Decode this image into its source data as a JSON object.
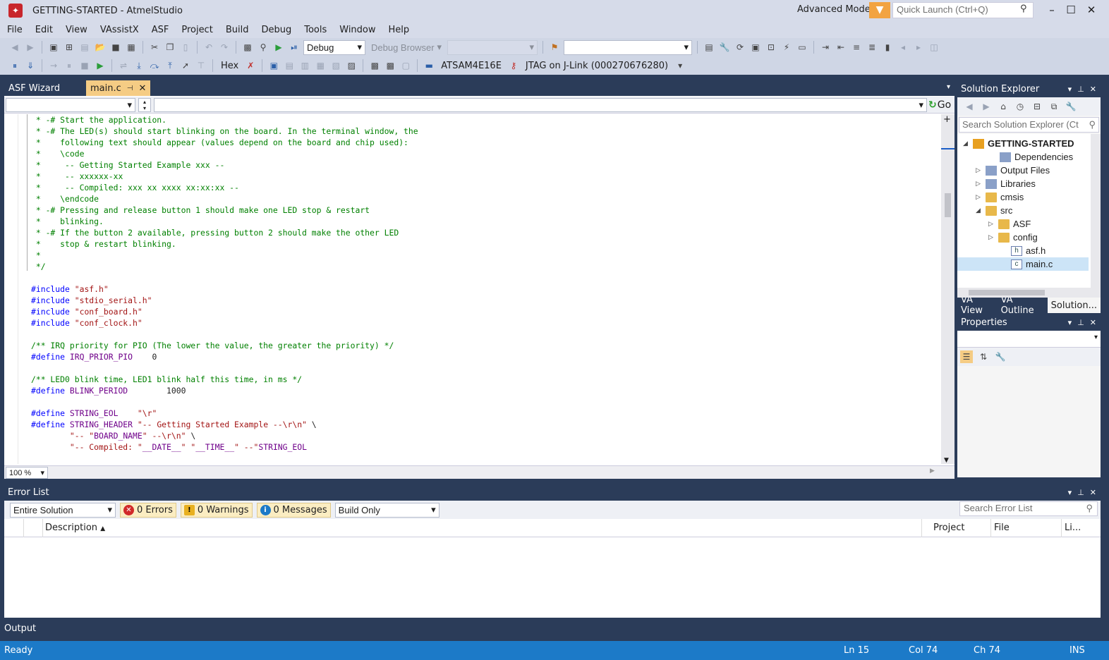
{
  "window": {
    "title": "GETTING-STARTED - AtmelStudio",
    "advanced_mode": "Advanced Mode",
    "quick_launch_placeholder": "Quick Launch (Ctrl+Q)"
  },
  "menu": [
    "File",
    "Edit",
    "View",
    "VAssistX",
    "ASF",
    "Project",
    "Build",
    "Debug",
    "Tools",
    "Window",
    "Help"
  ],
  "toolbar": {
    "config": "Debug",
    "debug_browser": "Debug Browser",
    "hex_label": "Hex",
    "device": "ATSAM4E16E",
    "tool": "JTAG on J-Link (000270676280)"
  },
  "tabs": {
    "asf_wizard": "ASF Wizard",
    "main_c": "main.c"
  },
  "nav": {
    "go": "Go"
  },
  "code_lines": [
    [
      {
        "c": "cm",
        "t": " * -# Start the application."
      }
    ],
    [
      {
        "c": "cm",
        "t": " * -# The LED(s) should start blinking on the board. In the terminal window, the"
      }
    ],
    [
      {
        "c": "cm",
        "t": " *    following text should appear (values depend on the board and chip used):"
      }
    ],
    [
      {
        "c": "cm",
        "t": " *    \\code"
      }
    ],
    [
      {
        "c": "cm",
        "t": " *     -- Getting Started Example xxx --"
      }
    ],
    [
      {
        "c": "cm",
        "t": " *     -- xxxxxx-xx"
      }
    ],
    [
      {
        "c": "cm",
        "t": " *     -- Compiled: xxx xx xxxx xx:xx:xx --"
      }
    ],
    [
      {
        "c": "cm",
        "t": " *    \\endcode"
      }
    ],
    [
      {
        "c": "cm",
        "t": " * -# Pressing and release button 1 should make one LED stop & restart"
      }
    ],
    [
      {
        "c": "cm",
        "t": " *    blinking."
      }
    ],
    [
      {
        "c": "cm",
        "t": " * -# If the button 2 available, pressing button 2 should make the other LED"
      }
    ],
    [
      {
        "c": "cm",
        "t": " *    stop & restart blinking."
      }
    ],
    [
      {
        "c": "cm",
        "t": " *"
      }
    ],
    [
      {
        "c": "cm",
        "t": " */"
      }
    ],
    [],
    [
      {
        "c": "kw",
        "t": "#include "
      },
      {
        "c": "st",
        "t": "\"asf.h\""
      }
    ],
    [
      {
        "c": "kw",
        "t": "#include "
      },
      {
        "c": "st",
        "t": "\"stdio_serial.h\""
      }
    ],
    [
      {
        "c": "kw",
        "t": "#include "
      },
      {
        "c": "st",
        "t": "\"conf_board.h\""
      }
    ],
    [
      {
        "c": "kw",
        "t": "#include "
      },
      {
        "c": "st",
        "t": "\"conf_clock.h\""
      }
    ],
    [],
    [
      {
        "c": "cm",
        "t": "/** IRQ priority for PIO (The lower the value, the greater the priority) */"
      }
    ],
    [
      {
        "c": "kw",
        "t": "#define "
      },
      {
        "c": "mc",
        "t": "IRQ_PRIOR_PIO"
      },
      {
        "c": "pl",
        "t": "    0"
      }
    ],
    [],
    [
      {
        "c": "cm",
        "t": "/** LED0 blink time, LED1 blink half this time, in ms */"
      }
    ],
    [
      {
        "c": "kw",
        "t": "#define "
      },
      {
        "c": "mc",
        "t": "BLINK_PERIOD"
      },
      {
        "c": "pl",
        "t": "        1000"
      }
    ],
    [],
    [
      {
        "c": "kw",
        "t": "#define "
      },
      {
        "c": "mc",
        "t": "STRING_EOL"
      },
      {
        "c": "pl",
        "t": "    "
      },
      {
        "c": "st",
        "t": "\"\\r\""
      }
    ],
    [
      {
        "c": "kw",
        "t": "#define "
      },
      {
        "c": "mc",
        "t": "STRING_HEADER "
      },
      {
        "c": "st",
        "t": "\"-- Getting Started Example --\\r\\n\""
      },
      {
        "c": "pl",
        "t": " \\"
      }
    ],
    [
      {
        "c": "pl",
        "t": "        "
      },
      {
        "c": "st",
        "t": "\"-- \""
      },
      {
        "c": "mc",
        "t": "BOARD_NAME"
      },
      {
        "c": "st",
        "t": "\" --\\r\\n\""
      },
      {
        "c": "pl",
        "t": " \\"
      }
    ],
    [
      {
        "c": "pl",
        "t": "        "
      },
      {
        "c": "st",
        "t": "\"-- Compiled: \""
      },
      {
        "c": "mc",
        "t": "__DATE__"
      },
      {
        "c": "st",
        "t": "\" \""
      },
      {
        "c": "mc",
        "t": "__TIME__"
      },
      {
        "c": "st",
        "t": "\" --\""
      },
      {
        "c": "mc",
        "t": "STRING_EOL"
      }
    ]
  ],
  "zoom": "100 %",
  "solution_explorer": {
    "title": "Solution Explorer",
    "search_placeholder": "Search Solution Explorer (Ct",
    "tree": [
      {
        "label": "GETTING-STARTED",
        "exp": "◢",
        "icon": "proj",
        "bold": true
      },
      {
        "label": "Dependencies",
        "exp": "",
        "icon": "refs"
      },
      {
        "label": "Output Files",
        "exp": "▷",
        "icon": "refs"
      },
      {
        "label": "Libraries",
        "exp": "▷",
        "icon": "refs"
      },
      {
        "label": "cmsis",
        "exp": "▷",
        "icon": "folder"
      },
      {
        "label": "src",
        "exp": "◢",
        "icon": "folder"
      },
      {
        "label": "ASF",
        "exp": "▷",
        "icon": "folder"
      },
      {
        "label": "config",
        "exp": "▷",
        "icon": "folder"
      },
      {
        "label": "asf.h",
        "exp": "",
        "icon": "fileh"
      },
      {
        "label": "main.c",
        "exp": "",
        "icon": "filec",
        "selected": true
      }
    ],
    "tabs": [
      "VA View",
      "VA Outline",
      "Solution..."
    ]
  },
  "properties": {
    "title": "Properties"
  },
  "error_list": {
    "title": "Error List",
    "scope": "Entire Solution",
    "errors": "0 Errors",
    "warnings": "0 Warnings",
    "messages": "0 Messages",
    "build_filter": "Build Only",
    "search_placeholder": "Search Error List",
    "col_description": "Description",
    "col_project": "Project",
    "col_file": "File",
    "col_line": "Li..."
  },
  "output_tab": "Output",
  "status": {
    "ready": "Ready",
    "ln": "Ln 15",
    "col": "Col 74",
    "ch": "Ch 74",
    "ins": "INS"
  },
  "colors": {
    "accent": "#1c7ac8",
    "active_tab": "#f5cc84",
    "frame": "#2b3c59",
    "comment": "#008000",
    "keyword": "#0000ff",
    "macro": "#6f008a",
    "string": "#a31515"
  }
}
